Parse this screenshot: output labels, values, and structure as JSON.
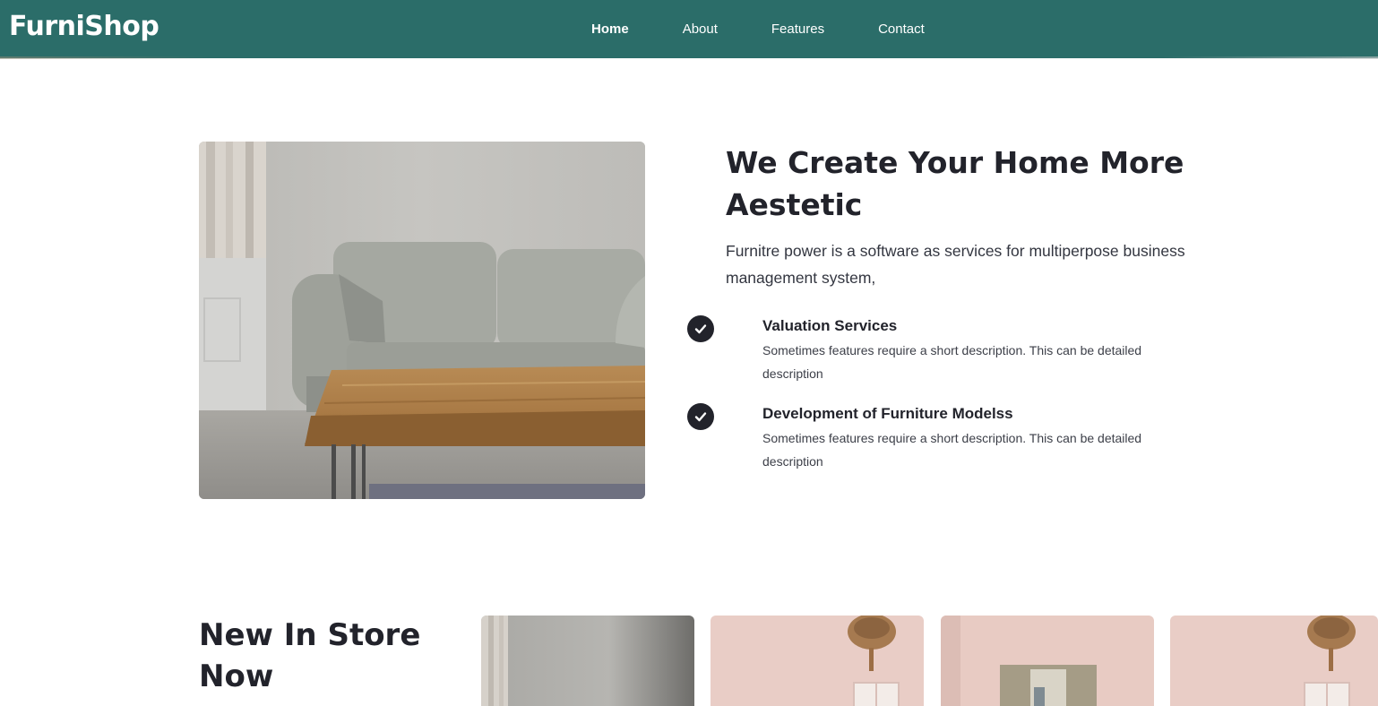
{
  "brand": {
    "name": "FurniShop"
  },
  "nav": {
    "items": [
      {
        "label": "Home"
      },
      {
        "label": "About"
      },
      {
        "label": "Features"
      },
      {
        "label": "Contact"
      }
    ]
  },
  "hero": {
    "image_alt_icon": "sofa-photo",
    "title": "We Create Your Home More Aestetic",
    "description": "Furnitre power is a software as services for multiperpose business management system,",
    "features": [
      {
        "icon": "check-circle-icon",
        "title": "Valuation Services",
        "description": "Sometimes features require a short description. This can be detailed description"
      },
      {
        "icon": "check-circle-icon",
        "title": "Development of Furniture Modelss",
        "description": "Sometimes features require a short description. This can be detailed description"
      }
    ]
  },
  "store": {
    "title": "New In Store Now"
  },
  "colors": {
    "navbar": "#2b6d69",
    "text_dark": "#22232b",
    "background": "#ffffff"
  }
}
